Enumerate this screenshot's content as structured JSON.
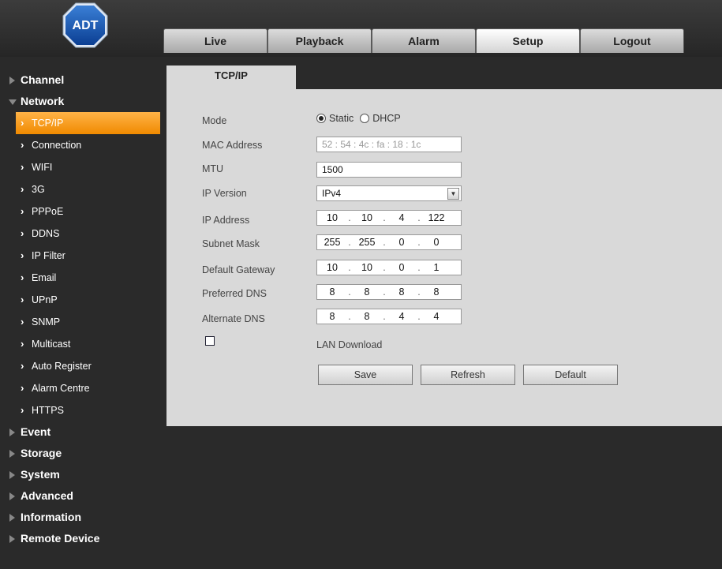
{
  "brand": {
    "logo_text": "ADT"
  },
  "nav_tabs": [
    {
      "label": "Live"
    },
    {
      "label": "Playback"
    },
    {
      "label": "Alarm"
    },
    {
      "label": "Setup",
      "active": true
    },
    {
      "label": "Logout"
    }
  ],
  "sidebar": {
    "channel": "Channel",
    "network": "Network",
    "network_items": [
      {
        "label": "TCP/IP",
        "active": true
      },
      {
        "label": "Connection"
      },
      {
        "label": "WIFI"
      },
      {
        "label": "3G"
      },
      {
        "label": "PPPoE"
      },
      {
        "label": "DDNS"
      },
      {
        "label": "IP Filter"
      },
      {
        "label": "Email"
      },
      {
        "label": "UPnP"
      },
      {
        "label": "SNMP"
      },
      {
        "label": "Multicast"
      },
      {
        "label": "Auto Register"
      },
      {
        "label": "Alarm Centre"
      },
      {
        "label": "HTTPS"
      }
    ],
    "event": "Event",
    "storage": "Storage",
    "system": "System",
    "advanced": "Advanced",
    "information": "Information",
    "remote_device": "Remote Device"
  },
  "page": {
    "title": "TCP/IP",
    "mode": {
      "label": "Mode",
      "options": [
        "Static",
        "DHCP"
      ],
      "selected": "Static"
    },
    "mac": {
      "label": "MAC Address",
      "value": "52 : 54 : 4c : fa : 18 : 1c"
    },
    "mtu": {
      "label": "MTU",
      "value": "1500"
    },
    "ip_version": {
      "label": "IP Version",
      "value": "IPv4"
    },
    "ip_address": {
      "label": "IP Address",
      "octets": [
        "10",
        "10",
        "4",
        "122"
      ]
    },
    "subnet_mask": {
      "label": "Subnet Mask",
      "octets": [
        "255",
        "255",
        "0",
        "0"
      ]
    },
    "default_gateway": {
      "label": "Default Gateway",
      "octets": [
        "10",
        "10",
        "0",
        "1"
      ]
    },
    "preferred_dns": {
      "label": "Preferred DNS",
      "octets": [
        "8",
        "8",
        "8",
        "8"
      ]
    },
    "alternate_dns": {
      "label": "Alternate DNS",
      "octets": [
        "8",
        "8",
        "4",
        "4"
      ]
    },
    "lan_download": {
      "label": "LAN Download",
      "checked": false
    },
    "buttons": {
      "save": "Save",
      "refresh": "Refresh",
      "default": "Default"
    }
  },
  "colors": {
    "active_orange": "#f59a1b",
    "panel_gray": "#d9d9d9",
    "background": "#2a2a2a"
  }
}
